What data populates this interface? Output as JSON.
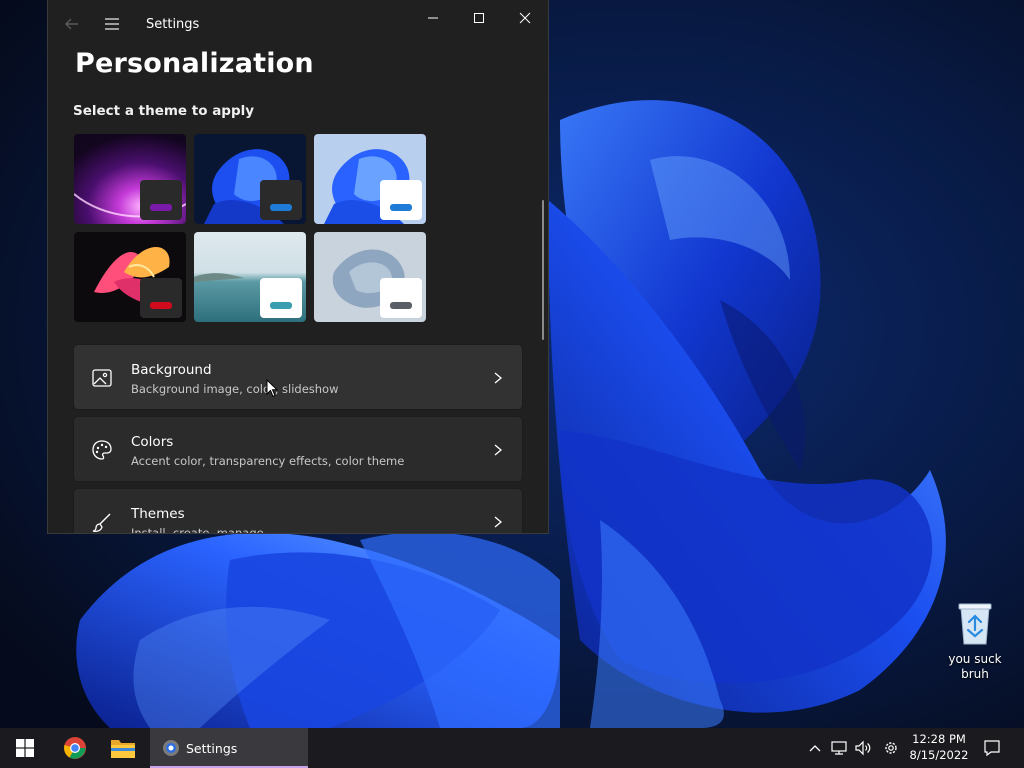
{
  "window": {
    "title": "Settings",
    "page_title": "Personalization",
    "section_label": "Select a theme to apply"
  },
  "themes": [
    {
      "name": "glow",
      "accent": "#7a1aa8"
    },
    {
      "name": "dark-bloom",
      "accent": "#1e7bd6"
    },
    {
      "name": "light-bloom",
      "accent": "#1e7bd6"
    },
    {
      "name": "captured-motion",
      "accent": "#d10a1e"
    },
    {
      "name": "sunrise-lake",
      "accent": "#3a9db0"
    },
    {
      "name": "flow",
      "accent": "#5a5f66"
    }
  ],
  "cards": [
    {
      "title": "Background",
      "subtitle": "Background image, color, slideshow",
      "icon": "image-icon"
    },
    {
      "title": "Colors",
      "subtitle": "Accent color, transparency effects, color theme",
      "icon": "palette-icon"
    },
    {
      "title": "Themes",
      "subtitle": "Install, create, manage",
      "icon": "brush-icon"
    }
  ],
  "desktop": {
    "recycle_bin_label": "you suck bruh"
  },
  "taskbar": {
    "active_app_label": "Settings",
    "time": "12:28 PM",
    "date": "8/15/2022"
  },
  "colors": {
    "window_bg": "#202020",
    "card_bg": "#2b2b2b",
    "taskbar_bg": "#1b1b1f",
    "active_underline": "#c7a3ea"
  }
}
